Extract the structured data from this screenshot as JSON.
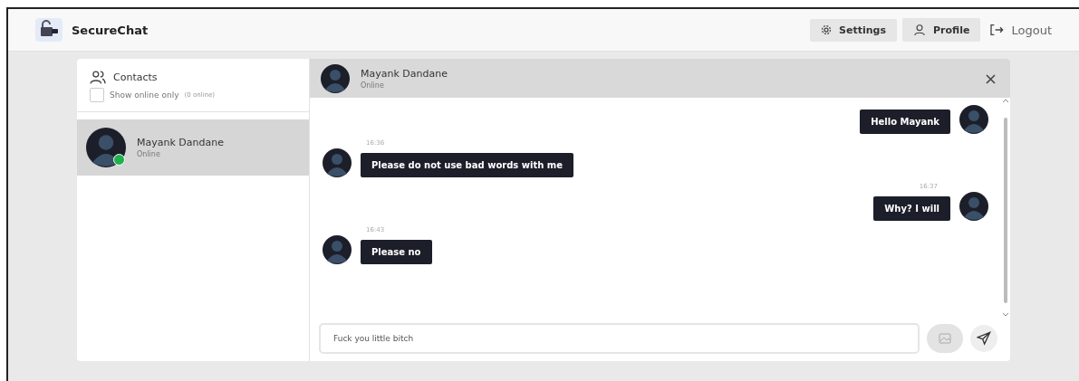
{
  "app": {
    "title": "SecureChat"
  },
  "nav": [
    {
      "kind": "settings",
      "label": "Settings"
    },
    {
      "kind": "profile",
      "label": "Profile"
    },
    {
      "kind": "logout",
      "label": "Logout"
    }
  ],
  "contacts": {
    "title": "Contacts",
    "filter": {
      "label": "Show online only",
      "checked": false,
      "count": "(0 online)"
    },
    "items": [
      {
        "name": "Mayank Dandane",
        "status": "Online",
        "online": true,
        "selected": true
      }
    ]
  },
  "chat": {
    "name": "Mayank Dandane",
    "status": "Online",
    "messages": [
      {
        "kind": "sent",
        "text": "Hello Mayank"
      },
      {
        "kind": "received",
        "time": "16:36",
        "text": "Please do not use bad words with me"
      },
      {
        "kind": "sent",
        "time": "16:37",
        "text": "Why? I will"
      },
      {
        "kind": "received",
        "time": "16:43",
        "text": "Please no"
      }
    ],
    "input": {
      "value": "Fuck you little bitch"
    }
  }
}
